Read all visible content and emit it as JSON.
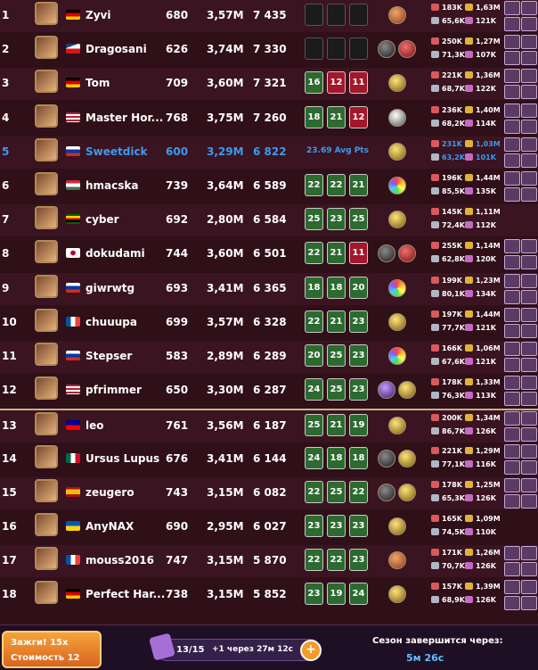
{
  "colors": {
    "accent_blue": "#3b9bf0",
    "win_tile": "#2c6a30",
    "loss_tile": "#a3172a",
    "row_bg": "#3a1420",
    "footer_button": "#e8822a"
  },
  "players": [
    {
      "rank": "1",
      "flag": "de",
      "name": "Zyvi",
      "level": "680",
      "power": "3,57M",
      "points": "7 435",
      "tiles": [
        {
          "v": "",
          "type": "blank"
        },
        {
          "v": "",
          "type": "blank"
        },
        {
          "v": "",
          "type": "blank"
        }
      ],
      "orbs": [
        "brown"
      ],
      "hp": "183K",
      "mana": "65,6K",
      "key": "1,63M",
      "ego": "121K",
      "cards": 4
    },
    {
      "rank": "2",
      "flag": "cz",
      "name": "Dragosani",
      "level": "626",
      "power": "3,74M",
      "points": "7 330",
      "tiles": [
        {
          "v": "",
          "type": "blank"
        },
        {
          "v": "",
          "type": "blank"
        },
        {
          "v": "",
          "type": "blank"
        }
      ],
      "orbs": [
        "dark",
        "red"
      ],
      "hp": "250K",
      "mana": "71,3K",
      "key": "1,27M",
      "ego": "107K",
      "cards": 4
    },
    {
      "rank": "3",
      "flag": "de",
      "name": "Tom",
      "level": "709",
      "power": "3,60M",
      "points": "7 321",
      "tiles": [
        {
          "v": "16",
          "type": "win"
        },
        {
          "v": "12",
          "type": "loss"
        },
        {
          "v": "11",
          "type": "loss"
        }
      ],
      "orbs": [
        "gold"
      ],
      "hp": "221K",
      "mana": "68,7K",
      "key": "1,36M",
      "ego": "122K",
      "cards": 4
    },
    {
      "rank": "4",
      "flag": "us",
      "name": "Master Hor...",
      "level": "768",
      "power": "3,75M",
      "points": "7 260",
      "tiles": [
        {
          "v": "18",
          "type": "win"
        },
        {
          "v": "21",
          "type": "win"
        },
        {
          "v": "12",
          "type": "loss"
        }
      ],
      "orbs": [
        "grey"
      ],
      "hp": "236K",
      "mana": "68,2K",
      "key": "1,40M",
      "ego": "114K",
      "cards": 4
    },
    {
      "rank": "5",
      "flag": "ru",
      "name": "Sweetdick",
      "level": "600",
      "power": "3,29M",
      "points": "6 822",
      "avg": "23.69 Avg Pts",
      "me": true,
      "orbs": [
        "gold"
      ],
      "hp": "231K",
      "mana": "63,2K",
      "key": "1,03M",
      "ego": "101K",
      "cards": 4
    },
    {
      "rank": "6",
      "flag": "hu",
      "name": "hmacska",
      "level": "739",
      "power": "3,64M",
      "points": "6 589",
      "tiles": [
        {
          "v": "22",
          "type": "win"
        },
        {
          "v": "22",
          "type": "win"
        },
        {
          "v": "21",
          "type": "win"
        }
      ],
      "orbs": [
        "rainbow"
      ],
      "hp": "196K",
      "mana": "85,5K",
      "key": "1,44M",
      "ego": "135K",
      "cards": 4
    },
    {
      "rank": "7",
      "flag": "zw",
      "name": "cyber",
      "level": "692",
      "power": "2,80M",
      "points": "6 584",
      "tiles": [
        {
          "v": "25",
          "type": "win"
        },
        {
          "v": "23",
          "type": "win"
        },
        {
          "v": "25",
          "type": "win"
        }
      ],
      "orbs": [
        "gold"
      ],
      "hp": "145K",
      "mana": "72,4K",
      "key": "1,11M",
      "ego": "112K",
      "cards": 0
    },
    {
      "rank": "8",
      "flag": "jp",
      "name": "dokudami",
      "level": "744",
      "power": "3,60M",
      "points": "6 501",
      "tiles": [
        {
          "v": "22",
          "type": "win"
        },
        {
          "v": "21",
          "type": "win"
        },
        {
          "v": "11",
          "type": "loss"
        }
      ],
      "orbs": [
        "dark",
        "red"
      ],
      "hp": "255K",
      "mana": "62,8K",
      "key": "1,14M",
      "ego": "120K",
      "cards": 4
    },
    {
      "rank": "9",
      "flag": "ru",
      "name": "giwrwtg",
      "level": "693",
      "power": "3,41M",
      "points": "6 365",
      "tiles": [
        {
          "v": "18",
          "type": "win"
        },
        {
          "v": "18",
          "type": "win"
        },
        {
          "v": "20",
          "type": "win"
        }
      ],
      "orbs": [
        "rainbow"
      ],
      "hp": "199K",
      "mana": "80,1K",
      "key": "1,23M",
      "ego": "134K",
      "cards": 4
    },
    {
      "rank": "10",
      "flag": "fr",
      "name": "chuuupa",
      "level": "699",
      "power": "3,57M",
      "points": "6 328",
      "tiles": [
        {
          "v": "22",
          "type": "win"
        },
        {
          "v": "21",
          "type": "win"
        },
        {
          "v": "23",
          "type": "win"
        }
      ],
      "orbs": [
        "gold"
      ],
      "hp": "197K",
      "mana": "77,7K",
      "key": "1,44M",
      "ego": "121K",
      "cards": 4
    },
    {
      "rank": "11",
      "flag": "ru",
      "name": "Stepser",
      "level": "583",
      "power": "2,89M",
      "points": "6 289",
      "tiles": [
        {
          "v": "20",
          "type": "win"
        },
        {
          "v": "25",
          "type": "win"
        },
        {
          "v": "23",
          "type": "win"
        }
      ],
      "orbs": [
        "rainbow"
      ],
      "hp": "166K",
      "mana": "67,6K",
      "key": "1,06M",
      "ego": "121K",
      "cards": 4
    },
    {
      "rank": "12",
      "flag": "us",
      "name": "pfrimmer",
      "level": "650",
      "power": "3,30M",
      "points": "6 287",
      "tiles": [
        {
          "v": "24",
          "type": "win"
        },
        {
          "v": "25",
          "type": "win"
        },
        {
          "v": "23",
          "type": "win"
        }
      ],
      "orbs": [
        "purple",
        "gold"
      ],
      "hp": "178K",
      "mana": "76,3K",
      "key": "1,33M",
      "ego": "113K",
      "cards": 4
    },
    {
      "rank": "13",
      "flag": "tw",
      "name": "leo",
      "level": "761",
      "power": "3,56M",
      "points": "6 187",
      "tiles": [
        {
          "v": "25",
          "type": "win"
        },
        {
          "v": "21",
          "type": "win"
        },
        {
          "v": "19",
          "type": "win"
        }
      ],
      "orbs": [
        "gold"
      ],
      "hp": "200K",
      "mana": "86,7K",
      "key": "1,34M",
      "ego": "126K",
      "cards": 4,
      "sep": true
    },
    {
      "rank": "14",
      "flag": "mx",
      "name": "Ursus Lupus",
      "level": "676",
      "power": "3,41M",
      "points": "6 144",
      "tiles": [
        {
          "v": "24",
          "type": "win"
        },
        {
          "v": "18",
          "type": "win"
        },
        {
          "v": "18",
          "type": "win"
        }
      ],
      "orbs": [
        "dark",
        "gold"
      ],
      "hp": "221K",
      "mana": "77,1K",
      "key": "1,29M",
      "ego": "116K",
      "cards": 4
    },
    {
      "rank": "15",
      "flag": "es",
      "name": "zeugero",
      "level": "743",
      "power": "3,15M",
      "points": "6 082",
      "tiles": [
        {
          "v": "22",
          "type": "win"
        },
        {
          "v": "25",
          "type": "win"
        },
        {
          "v": "22",
          "type": "win"
        }
      ],
      "orbs": [
        "dark",
        "gold"
      ],
      "hp": "178K",
      "mana": "65,3K",
      "key": "1,25M",
      "ego": "126K",
      "cards": 4
    },
    {
      "rank": "16",
      "flag": "ua",
      "name": "AnyNAX",
      "level": "690",
      "power": "2,95M",
      "points": "6 027",
      "tiles": [
        {
          "v": "23",
          "type": "win"
        },
        {
          "v": "23",
          "type": "win"
        },
        {
          "v": "23",
          "type": "win"
        }
      ],
      "orbs": [
        "gold"
      ],
      "hp": "165K",
      "mana": "74,5K",
      "key": "1,09M",
      "ego": "110K",
      "cards": 0
    },
    {
      "rank": "17",
      "flag": "fr",
      "name": "mouss2016",
      "level": "747",
      "power": "3,15M",
      "points": "5 870",
      "tiles": [
        {
          "v": "22",
          "type": "win"
        },
        {
          "v": "22",
          "type": "win"
        },
        {
          "v": "23",
          "type": "win"
        }
      ],
      "orbs": [
        "brown"
      ],
      "hp": "171K",
      "mana": "70,7K",
      "key": "1,26M",
      "ego": "126K",
      "cards": 4
    },
    {
      "rank": "18",
      "flag": "de",
      "name": "Perfect Har...",
      "level": "738",
      "power": "3,15M",
      "points": "5 852",
      "tiles": [
        {
          "v": "23",
          "type": "win"
        },
        {
          "v": "19",
          "type": "win"
        },
        {
          "v": "24",
          "type": "win"
        }
      ],
      "orbs": [
        "gold"
      ],
      "hp": "157K",
      "mana": "68,9K",
      "key": "1,39M",
      "ego": "126K",
      "cards": 4
    }
  ],
  "footer": {
    "zap_label": "Зажги! 15x",
    "zap_cost": "Стоимость 12",
    "energy_count": "13/15",
    "energy_refill": "+1 через 27м 12с",
    "energy_plus": "+",
    "season_label": "Сезон завершится через:",
    "season_time": "5м 26с"
  }
}
